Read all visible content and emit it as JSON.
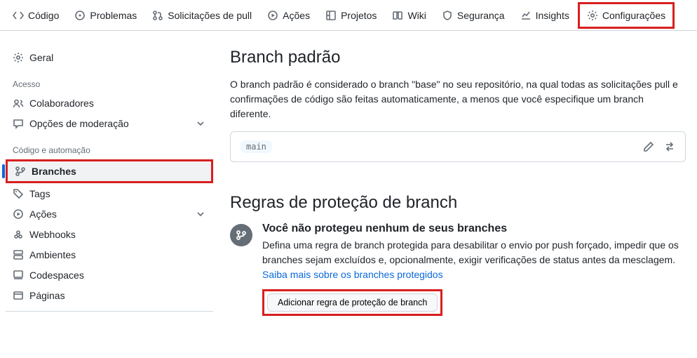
{
  "topnav": [
    {
      "label": "Código",
      "icon": "code"
    },
    {
      "label": "Problemas",
      "icon": "issue"
    },
    {
      "label": "Solicitações de pull",
      "icon": "pr"
    },
    {
      "label": "Ações",
      "icon": "play"
    },
    {
      "label": "Projetos",
      "icon": "project"
    },
    {
      "label": "Wiki",
      "icon": "book"
    },
    {
      "label": "Segurança",
      "icon": "shield"
    },
    {
      "label": "Insights",
      "icon": "graph"
    },
    {
      "label": "Configurações",
      "icon": "gear"
    }
  ],
  "sidebar": {
    "general": "Geral",
    "heading_access": "Acesso",
    "collaborators": "Colaboradores",
    "moderation": "Opções de moderação",
    "heading_code": "Código e automação",
    "branches": "Branches",
    "tags": "Tags",
    "actions": "Ações",
    "webhooks": "Webhooks",
    "environments": "Ambientes",
    "codespaces": "Codespaces",
    "pages": "Páginas"
  },
  "main": {
    "default_branch_title": "Branch padrão",
    "default_branch_desc": "O branch padrão é considerado o branch \"base\" no seu repositório, na qual todas as solicitações pull e confirmações de código são feitas automaticamente, a menos que você especifique um branch diferente.",
    "branch_name": "main",
    "rules_title": "Regras de proteção de branch",
    "protect_heading": "Você não protegeu nenhum de seus branches",
    "protect_desc": "Defina uma regra de branch protegida para desabilitar o envio por push forçado, impedir que os branches sejam excluídos e, opcionalmente, exigir verificações de status antes da mesclagem.",
    "protect_link": "Saiba mais sobre os branches protegidos",
    "add_rule_btn": "Adicionar regra de proteção de branch"
  }
}
